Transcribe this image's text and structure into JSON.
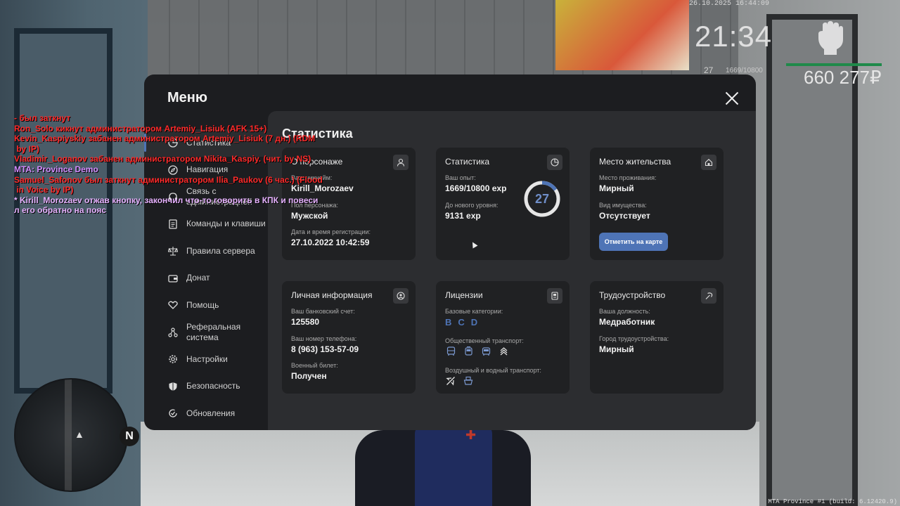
{
  "hud": {
    "datetime": "26.10.2025 16:44:09",
    "time": "21:34",
    "level": "27",
    "exp": "1669/10800",
    "money": "660 277₽",
    "build": "MTA Province #1 (build: 6.12420.9)",
    "minimap_north": "N"
  },
  "menu": {
    "title": "Меню",
    "sidebar": [
      {
        "label": "Статистика",
        "icon": "chart-pie-icon",
        "active": true
      },
      {
        "label": "Навигация",
        "icon": "compass-icon"
      },
      {
        "label": "Связь с администрацией",
        "icon": "headset-icon"
      },
      {
        "label": "Команды и клавиши",
        "icon": "document-icon"
      },
      {
        "label": "Правила сервера",
        "icon": "scales-icon"
      },
      {
        "label": "Донат",
        "icon": "wallet-icon"
      },
      {
        "label": "Помощь",
        "icon": "handshake-heart-icon"
      },
      {
        "label": "Реферальная система",
        "icon": "network-icon"
      },
      {
        "label": "Настройки",
        "icon": "gear-icon"
      },
      {
        "label": "Безопасность",
        "icon": "shield-icon"
      },
      {
        "label": "Обновления",
        "icon": "refresh-check-icon"
      }
    ],
    "content_title": "Статистика",
    "cards": {
      "character": {
        "title": "О персонаже",
        "fields": [
          {
            "label": "Ваш никнейм:",
            "value": "Kirill_Morozaev"
          },
          {
            "label": "Пол персонажа:",
            "value": "Мужской"
          },
          {
            "label": "Дата и время регистрации:",
            "value": "27.10.2022 10:42:59"
          }
        ]
      },
      "stats": {
        "title": "Статистика",
        "fields": [
          {
            "label": "Ваш опыт:",
            "value": "1669/10800 exp"
          },
          {
            "label": "До нового уровня:",
            "value": "9131 exp"
          }
        ],
        "level": "27",
        "progress": 0.1545
      },
      "residence": {
        "title": "Место жительства",
        "fields": [
          {
            "label": "Место проживания:",
            "value": "Мирный"
          },
          {
            "label": "Вид имущества:",
            "value": "Отсутствует"
          }
        ],
        "button": "Отметить на карте"
      },
      "personal": {
        "title": "Личная информация",
        "fields": [
          {
            "label": "Ваш банковский счет:",
            "value": "125580"
          },
          {
            "label": "Ваш номер телефона:",
            "value": "8 (963) 153-57-09"
          },
          {
            "label": "Военный билет:",
            "value": "Получен"
          }
        ]
      },
      "licenses": {
        "title": "Лицензии",
        "basic_label": "Базовые категории:",
        "basic": [
          "B",
          "C",
          "D"
        ],
        "public_label": "Общественный транспорт:",
        "public_icons": [
          "bus-icon",
          "tram-icon",
          "trolleybus-icon",
          "metro-icon"
        ],
        "air_label": "Воздушный и водный транспорт:",
        "air_icons": [
          "plane-icon",
          "ship-icon"
        ]
      },
      "employment": {
        "title": "Трудоустройство",
        "fields": [
          {
            "label": "Ваша должность:",
            "value": "Медработник"
          },
          {
            "label": "Город трудоустройства:",
            "value": "Мирный"
          }
        ]
      }
    }
  },
  "chat": [
    {
      "text": "- был заткнут",
      "color": "#ff2a2a"
    },
    {
      "text": "Ron_Solo кикнут администратором Artemiy_Lisiuk (AFK 15+)",
      "color": "#ff2a2a"
    },
    {
      "text": "Kevin_Kaspiyskiy забанен администратором Artemiy_Lisiuk (7 дн.) (RDM",
      "color": "#ff2a2a"
    },
    {
      "text": " by IP)",
      "color": "#ff2a2a"
    },
    {
      "text": "Vladimir_Loganov забанен администратором Nikita_Kaspiy. (чит. by NS)",
      "color": "#ff2a2a"
    },
    {
      "text": "MTA: Province Demo",
      "color": "#d48cff"
    },
    {
      "text": "Samuel_Safonov был заткнут администратором Ilia_Paukov (6 час.) (Flood",
      "color": "#ff2a2a"
    },
    {
      "text": " in Voice by IP)",
      "color": "#ff2a2a"
    },
    {
      "text": "* Kirill_Morozaev отжав кнопку, закончил что-то говорить в КПК и повеси",
      "color": "#e7b2ff"
    },
    {
      "text": "л его обратно на пояс",
      "color": "#e7b2ff"
    }
  ]
}
